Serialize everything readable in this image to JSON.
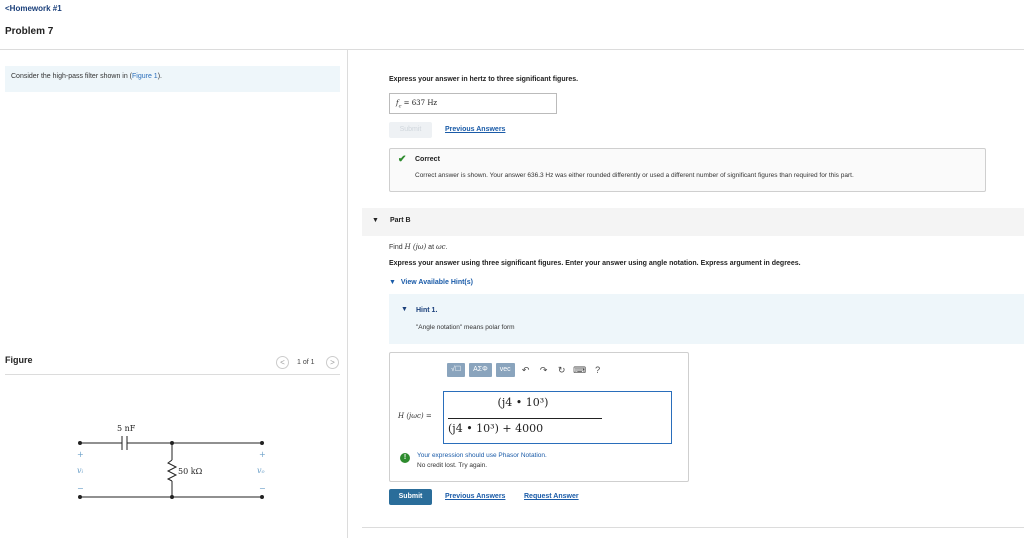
{
  "header": {
    "back_label": "<Homework #1",
    "problem_title": "Problem 7"
  },
  "left": {
    "prompt_prefix": "Consider the high-pass filter shown in (",
    "prompt_link": "Figure 1",
    "prompt_suffix": ").",
    "figure_label": "Figure",
    "pager_text": "1 of 1",
    "pager_prev": "<",
    "pager_next": ">",
    "circuit": {
      "capacitor_label": "5 nF",
      "resistor_label": "50 kΩ",
      "vi_label": "vᵢ",
      "vo_label": "vₒ",
      "plus": "+",
      "minus": "−"
    }
  },
  "part_a": {
    "instruction": "Express your answer in hertz to three significant figures.",
    "answer_var": "f",
    "answer_sub": "c",
    "answer_value": " = 637 ",
    "answer_unit": "Hz",
    "submit_label": "Submit",
    "previous_answers": "Previous Answers",
    "status_title": "Correct",
    "status_message": "Correct answer is shown. Your answer 636.3 Hz was either rounded differently or used a different number of significant figures than required for this part."
  },
  "part_b": {
    "label": "Part B",
    "find_prefix": "Find ",
    "find_expr": "H (jω)",
    "find_mid": " at ",
    "find_omega": "ωc",
    "find_suffix": ".",
    "instruction": "Express your answer using three significant figures. Enter your answer using angle notation. Express argument in degrees.",
    "hints_toggle": "View Available Hint(s)",
    "hint_title": "Hint 1.",
    "hint_text": "\"Angle notation\" means polar form",
    "toolbar": {
      "templates": "√☐",
      "greek": "ΑΣΦ",
      "vec": "vec",
      "undo": "↶",
      "redo": "↷",
      "reset": "↻",
      "keyboard": "⌨",
      "help": "?"
    },
    "expr_label": "H (jωc) =",
    "numerator": "(j4 • 10³)",
    "denominator": "(j4 • 10³) + 4000",
    "feedback_line1": "Your expression should use Phasor Notation.",
    "feedback_line2": "No credit lost. Try again.",
    "submit_label": "Submit",
    "previous_answers": "Previous Answers",
    "request_answer": "Request Answer"
  },
  "colors": {
    "link": "#1a5ba8",
    "hint_bg": "#eef6fa",
    "submit_bg": "#2a6d9a",
    "correct": "#2e8b2e"
  }
}
